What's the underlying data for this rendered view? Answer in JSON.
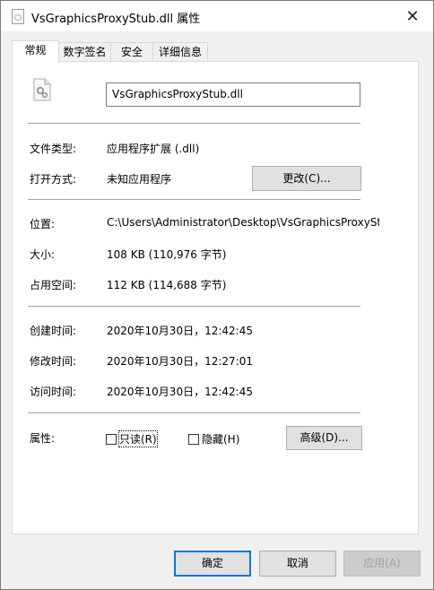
{
  "window": {
    "title": "VsGraphicsProxyStub.dll 属性",
    "close_glyph": "✕"
  },
  "tabs": [
    {
      "label": "常规",
      "active": true
    },
    {
      "label": "数字签名",
      "active": false
    },
    {
      "label": "安全",
      "active": false
    },
    {
      "label": "详细信息",
      "active": false
    }
  ],
  "general": {
    "file_name": "VsGraphicsProxyStub.dll",
    "file_type_label": "文件类型:",
    "file_type_value": "应用程序扩展 (.dll)",
    "open_with_label": "打开方式:",
    "open_with_value": "未知应用程序",
    "change_button": "更改(C)...",
    "location_label": "位置:",
    "location_value": "C:\\Users\\Administrator\\Desktop\\VsGraphicsProxyStub",
    "size_label": "大小:",
    "size_value": "108 KB (110,976 字节)",
    "size_on_disk_label": "占用空间:",
    "size_on_disk_value": "112 KB (114,688 字节)",
    "created_label": "创建时间:",
    "created_value": "2020年10月30日，12:42:45",
    "modified_label": "修改时间:",
    "modified_value": "2020年10月30日，12:27:01",
    "accessed_label": "访问时间:",
    "accessed_value": "2020年10月30日，12:42:45",
    "attributes_label": "属性:",
    "readonly_label": "只读(R)",
    "readonly_checked": false,
    "hidden_label": "隐藏(H)",
    "hidden_checked": false,
    "advanced_button": "高级(D)..."
  },
  "footer": {
    "ok": "确定",
    "cancel": "取消",
    "apply": "应用(A)"
  },
  "colors": {
    "accent": "#0078d7",
    "dialog_bg": "#f0f0f0",
    "panel_bg": "#ffffff",
    "button_bg": "#e1e1e1"
  }
}
